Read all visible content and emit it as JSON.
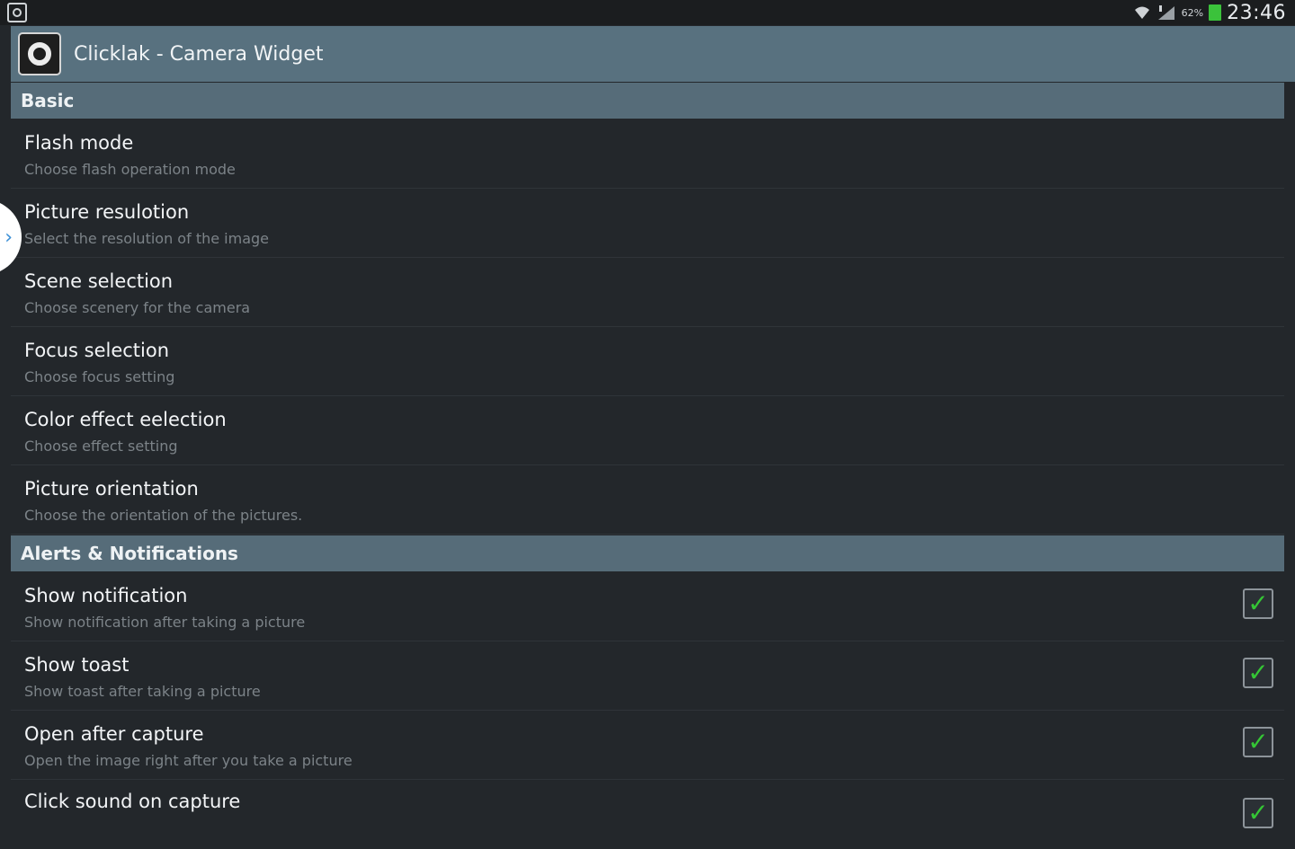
{
  "status_bar": {
    "battery_percent": "62%",
    "time": "23:46",
    "icons": [
      "camera-notification-icon",
      "wifi-icon",
      "signal-icon",
      "battery-icon"
    ],
    "battery_color": "#3bc23b"
  },
  "action_bar": {
    "title": "Clicklak - Camera Widget",
    "background_color": "#58717f"
  },
  "categories": [
    {
      "label": "Basic"
    },
    {
      "label": "Alerts & Notifications"
    }
  ],
  "basic_items": [
    {
      "title": "Flash mode",
      "summary": "Choose flash operation mode"
    },
    {
      "title": "Picture resulotion",
      "summary": "Select the resolution of the image"
    },
    {
      "title": "Scene selection",
      "summary": "Choose scenery for the camera"
    },
    {
      "title": "Focus selection",
      "summary": "Choose focus setting"
    },
    {
      "title": "Color effect eelection",
      "summary": "Choose effect setting"
    },
    {
      "title": "Picture orientation",
      "summary": "Choose the orientation of the pictures."
    }
  ],
  "alert_items": [
    {
      "title": "Show notification",
      "summary": "Show notification after taking a picture",
      "checked": true
    },
    {
      "title": "Show toast",
      "summary": "Show toast after taking a picture",
      "checked": true
    },
    {
      "title": "Open after capture",
      "summary": "Open the image right after you take a picture",
      "checked": true
    },
    {
      "title": "Click sound on capture",
      "summary": "",
      "checked": true
    }
  ],
  "side_handle": {
    "icon": "chevron-right-icon",
    "glyph": "›"
  },
  "checkmark_glyph": "✓",
  "accent_color": "#35c635"
}
